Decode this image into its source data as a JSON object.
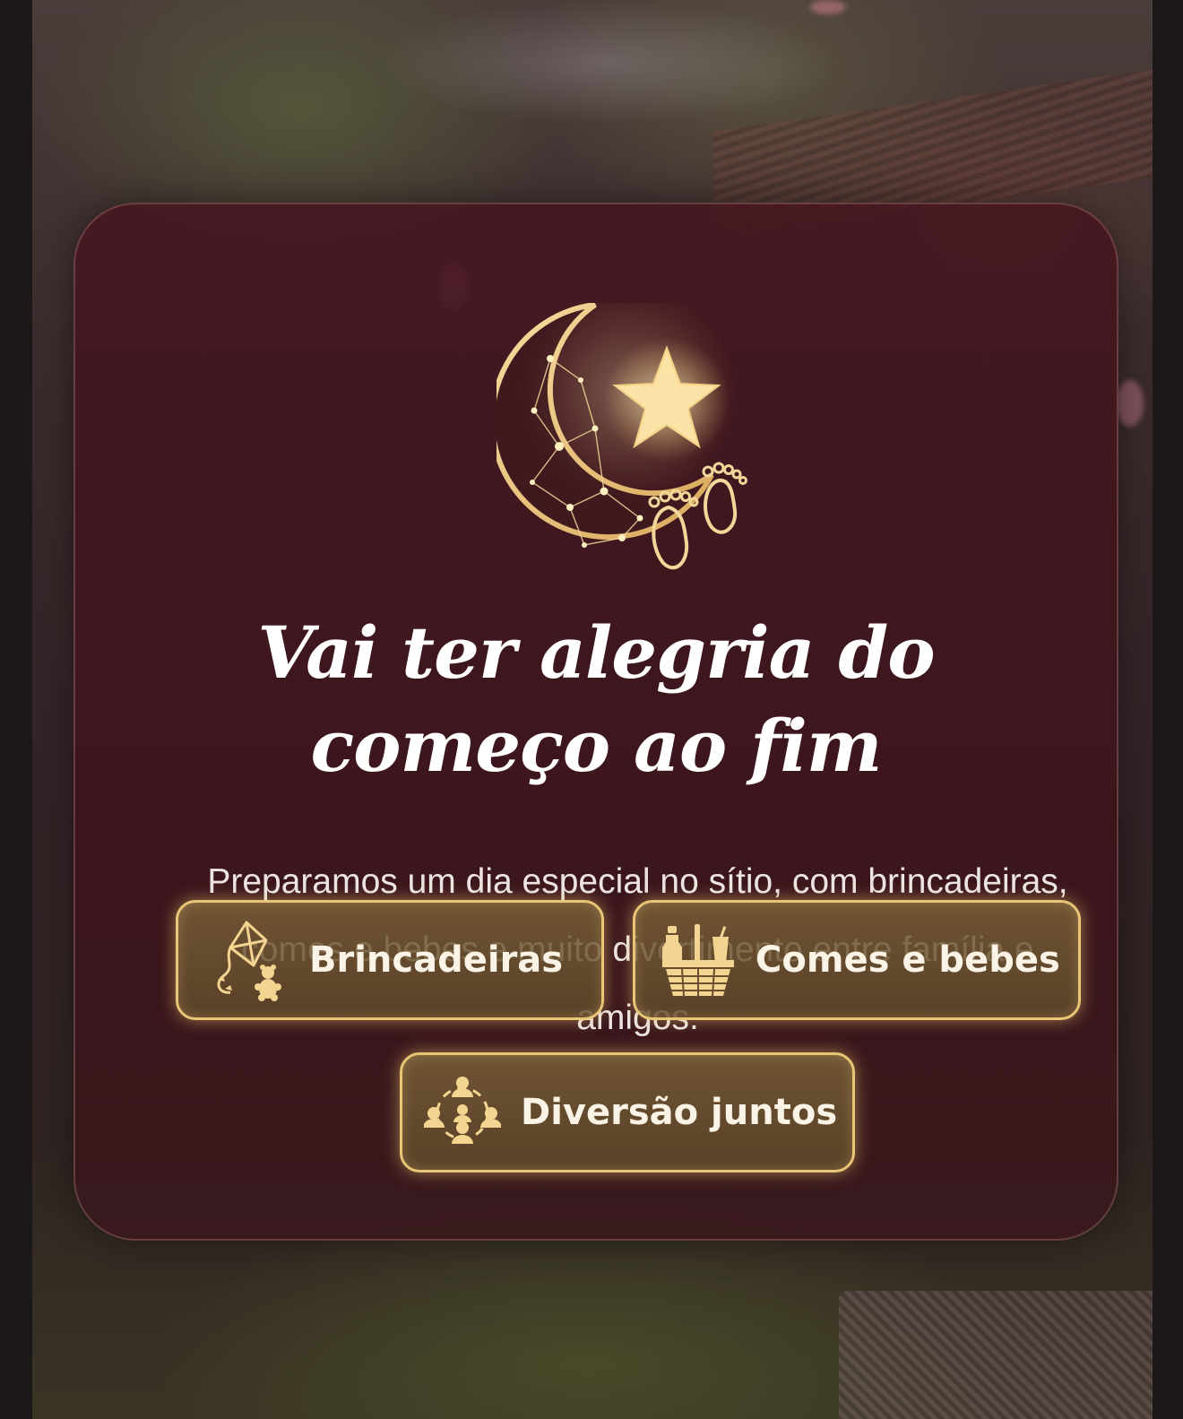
{
  "hero": {
    "title_line1": "Vai ter alegria do",
    "title_line2": "começo ao fim",
    "description": "Preparamos um dia especial no sítio, com brincadeiras, comes e bebes e muito divertimento entre família e amigos."
  },
  "emblem": {
    "icon": "moon-star-baby-feet-icon"
  },
  "features": [
    {
      "label": "Brincadeiras",
      "icon": "kite-teddy-bear-icon"
    },
    {
      "label": "Comes e bebes",
      "icon": "picnic-basket-drinks-icon"
    },
    {
      "label": "Diversão juntos",
      "icon": "people-circle-icon"
    }
  ],
  "colors": {
    "gold": "#e8c676",
    "card_bg": "#461620",
    "text_light": "#ffffff"
  }
}
